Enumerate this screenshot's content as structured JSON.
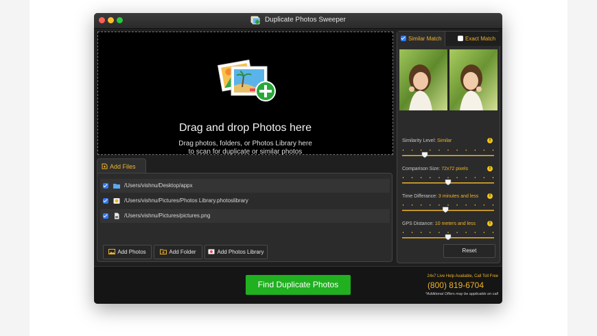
{
  "window": {
    "title": "Duplicate Photos Sweeper"
  },
  "dropzone": {
    "title": "Drag and drop Photos here",
    "subtitle_line1": "Drag photos, folders, or Photos Library here",
    "subtitle_line2": "to scan for duplicate or similar photos"
  },
  "files": {
    "tab_label": "Add Files",
    "items": [
      {
        "path": "/Users/vishnu/Desktop/appx",
        "checked": true,
        "icon": "folder-icon"
      },
      {
        "path": "/Users/vishnu/Pictures/Photos Library.photoslibrary",
        "checked": true,
        "icon": "photos-library-icon"
      },
      {
        "path": "/Users/vishnu/Pictures/pictures.png",
        "checked": true,
        "icon": "file-icon"
      }
    ],
    "buttons": {
      "add_photos": "Add Photos",
      "add_folder": "Add Folder",
      "add_photos_library": "Add Photos Library"
    }
  },
  "match": {
    "similar_label": "Similar Match",
    "similar_checked": true,
    "exact_label": "Exact Match",
    "exact_checked": false
  },
  "settings": [
    {
      "label": "Similarity Level:",
      "value": "Similar",
      "level": 0.23
    },
    {
      "label": "Comparison Size:",
      "value": "72x72 pixels",
      "level": 0.5
    },
    {
      "label": "Time Differance:",
      "value": "3 minutes and less",
      "level": 0.47
    },
    {
      "label": "GPS Distance:",
      "value": "10 meters and less",
      "level": 0.5
    }
  ],
  "reset_label": "Reset",
  "footer": {
    "find_button": "Find Duplicate Photos",
    "help_text": "24x7 Live Help Available, Call Toll Free",
    "phone": "(800) 819-6704",
    "offer_text": "*Additional Offers may be applicable on call"
  },
  "colors": {
    "accent": "#f0b429",
    "find_button": "#20b020",
    "checkbox": "#2f7bf5"
  }
}
